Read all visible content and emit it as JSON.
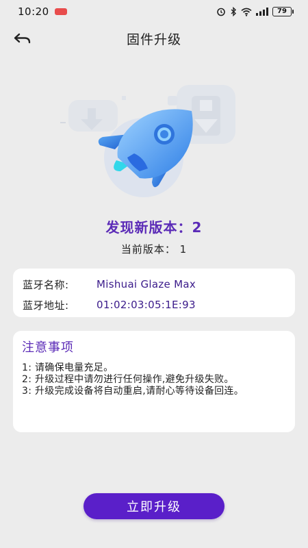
{
  "status_bar": {
    "time": "10:20",
    "battery": "79",
    "icons": [
      "alarm-icon",
      "bluetooth-icon",
      "wifi-icon",
      "signal-icon",
      "battery-icon"
    ]
  },
  "header": {
    "title": "固件升级",
    "back_icon": "back-arrow-icon"
  },
  "hero": {
    "icon": "rocket-icon"
  },
  "version": {
    "new_label": "发现新版本：2",
    "current_label": "当前版本：  1"
  },
  "bluetooth": {
    "name_label": "蓝牙名称:",
    "name_value": "Mishuai Glaze Max",
    "address_label": "蓝牙地址:",
    "address_value": "01:02:03:05:1E:93"
  },
  "notice": {
    "title": "注意事项",
    "items": [
      "1:  请确保电量充足。",
      "2:  升级过程中请勿进行任何操作,避免升级失败。",
      "3:  升级完成设备将自动重启,请耐心等待设备回连。"
    ]
  },
  "actions": {
    "upgrade_label": "立即升级"
  },
  "colors": {
    "accent": "#5a1fc9",
    "title_purple": "#5b2bb7",
    "background": "#ececec",
    "card": "#ffffff"
  }
}
